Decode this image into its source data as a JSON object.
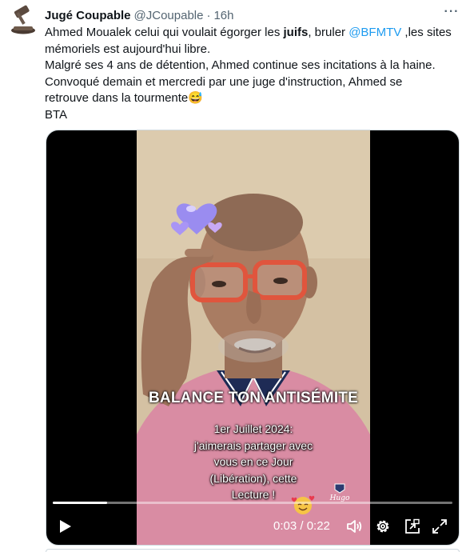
{
  "tweet": {
    "author_name": "Jugé Coupable",
    "handle": "@JCoupable",
    "separator": "·",
    "time": "16h",
    "more_label": "···",
    "avatar_icon": "gavel-icon",
    "lines": {
      "l1_a": "Ahmed Moualek celui qui voulait égorger les ",
      "l1_bold": "juifs",
      "l1_b": ", bruler ",
      "l1_mention": "@BFMTV",
      "l1_c": " ,les sites",
      "l2": "mémoriels est aujourd'hui libre.",
      "l3": "Malgré ses 4 ans de détention, Ahmed continue ses incitations à la haine.",
      "l4": "Convoqué demain et mercredi par une juge d'instruction, Ahmed se",
      "l5": "retrouve dans la tourmente",
      "l5_emoji": "😅",
      "l6": "BTA"
    }
  },
  "video": {
    "overlay_title": "BALANCE TON ANTISÉMITE",
    "caption_lines": [
      "1er Juillet 2024:",
      "j'aimerais partager avec",
      "vous en ce Jour",
      "(Libération), cette",
      "Lecture !"
    ],
    "time_readout": "0:03 / 0:22",
    "progress_fraction": 0.136,
    "watermark_text": "Hugo",
    "icons": {
      "play": "play-icon",
      "volume": "volume-icon",
      "settings": "gear-icon",
      "pip": "picture-in-picture-icon",
      "fullscreen": "fullscreen-icon"
    }
  },
  "colors": {
    "mention": "#1d9bf0",
    "secondary_text": "#536471",
    "text": "#0f1419",
    "shirt": "#d98ca3"
  }
}
